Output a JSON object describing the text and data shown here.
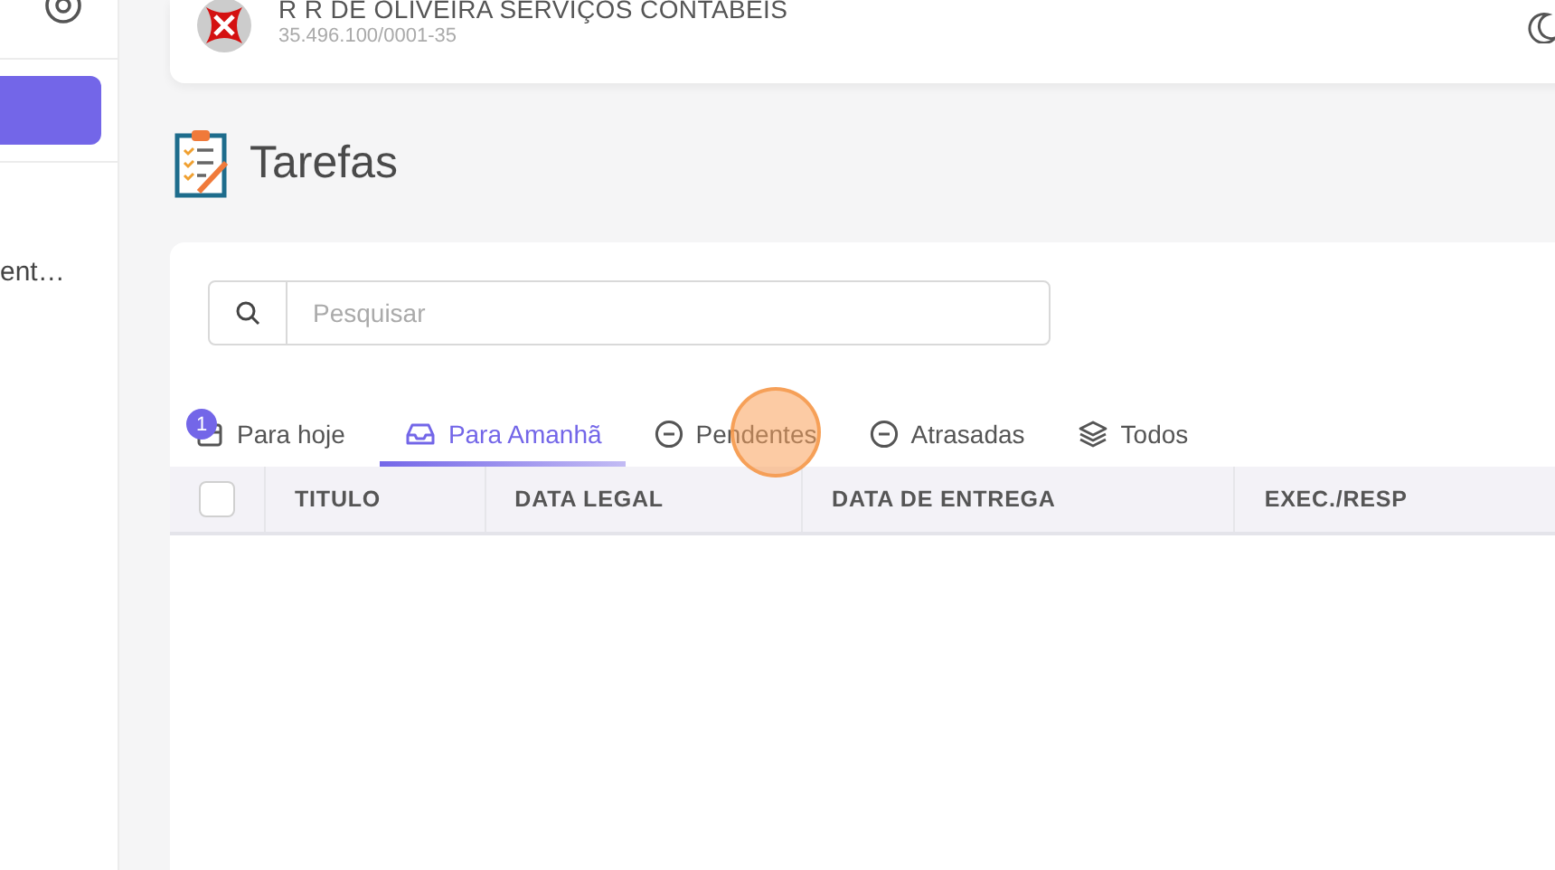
{
  "sidebar": {
    "item_text": "ent…"
  },
  "company": {
    "name": "R R DE OLIVEIRA SERVIÇOS CONTABEIS",
    "cnpj": "35.496.100/0001-35"
  },
  "page_title": "Tarefas",
  "search": {
    "placeholder": "Pesquisar"
  },
  "tabs": [
    {
      "label": "Para hoje",
      "kind": "calendar",
      "badge": "1",
      "selected": false
    },
    {
      "label": "Para Amanhã",
      "kind": "inbox",
      "selected": true
    },
    {
      "label": "Pendentes",
      "kind": "minus",
      "selected": false
    },
    {
      "label": "Atrasadas",
      "kind": "minus",
      "selected": false
    },
    {
      "label": "Todos",
      "kind": "layers",
      "selected": false
    }
  ],
  "table": {
    "select_all_checked": false,
    "columns": [
      "TITULO",
      "DATA LEGAL",
      "DATA DE ENTREGA",
      "EXEC./RESP"
    ]
  }
}
